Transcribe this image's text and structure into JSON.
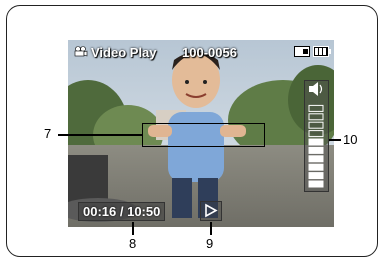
{
  "screen": {
    "mode_icon": "video-camera-icon",
    "mode_title": "Video Play",
    "file_number": "100-0056",
    "card_icon": "memory-card-icon",
    "battery_icon": "battery-icon",
    "timecode": "00:16 / 10:50",
    "play_icon": "play-icon",
    "volume_icon": "speaker-icon",
    "volume_level_fraction": 0.55
  },
  "callouts": {
    "c7": "7",
    "c8": "8",
    "c9": "9",
    "c10": "10"
  },
  "colors": {
    "sky": "#c9d9e8",
    "foliage": "#6e8a52",
    "ground": "#8b8a7c",
    "shirt": "#7fa7d8",
    "hud": "#ffffff"
  }
}
